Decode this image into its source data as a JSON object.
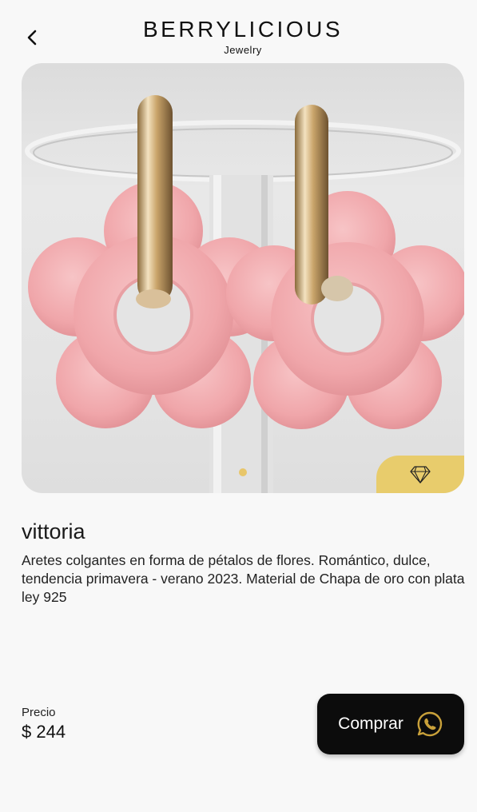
{
  "header": {
    "brand_name": "BERRYLICIOUS",
    "brand_sub": "Jewelry",
    "back_icon": "chevron-left-icon"
  },
  "gallery": {
    "image_subject": "pink flower hoop earrings",
    "page_count": 1,
    "current_page": 1,
    "badge_icon": "diamond-icon"
  },
  "product": {
    "name": "vittoria",
    "description": "Aretes colgantes en forma de pétalos de flores. Romántico, dulce, tendencia primavera - verano 2023. Material de Chapa de oro con plata ley  925"
  },
  "pricing": {
    "label": "Precio",
    "value": "$ 244"
  },
  "actions": {
    "buy_label": "Comprar",
    "buy_icon": "whatsapp-icon"
  },
  "colors": {
    "accent": "#e8cc6c",
    "button_bg": "#0c0c0c",
    "whatsapp_icon": "#c9a13a"
  }
}
